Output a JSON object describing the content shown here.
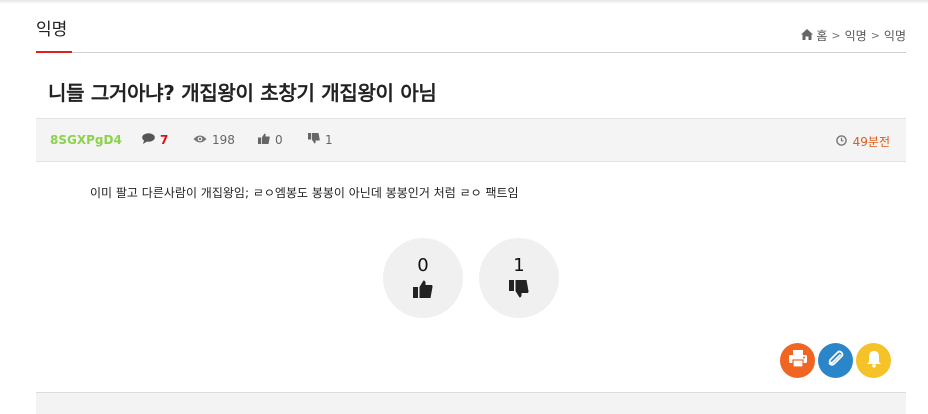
{
  "board": {
    "title": "익명"
  },
  "breadcrumb": {
    "home": "홈",
    "level1": "익명",
    "level2": "익명"
  },
  "post": {
    "title": "니들 그거아냐? 개집왕이 초창기 개집왕이 아님",
    "author": "8SGXPgD4",
    "comments": "7",
    "views": "198",
    "likes": "0",
    "dislikes": "1",
    "time": "49분전",
    "body": "이미 팔고 다른사람이 개집왕임; ㄹㅇ엠봉도 봉봉이 아닌데 봉봉인거 처럼 ㄹㅇ 팩트임"
  },
  "vote": {
    "up_count": "0",
    "down_count": "1"
  },
  "icons": {
    "home": "home-icon",
    "comment": "comment-icon",
    "view": "eye-icon",
    "like": "thumbs-up-icon",
    "dislike": "thumbs-down-icon",
    "clock": "clock-icon",
    "print": "print-icon",
    "attach": "paperclip-icon",
    "bell": "bell-icon"
  },
  "colors": {
    "accent_red": "#e02020",
    "author_green": "#8bd34a",
    "time_orange": "#e05a18",
    "print_btn": "#f06521",
    "attach_btn": "#2a86c8",
    "bell_btn": "#f5c228"
  }
}
